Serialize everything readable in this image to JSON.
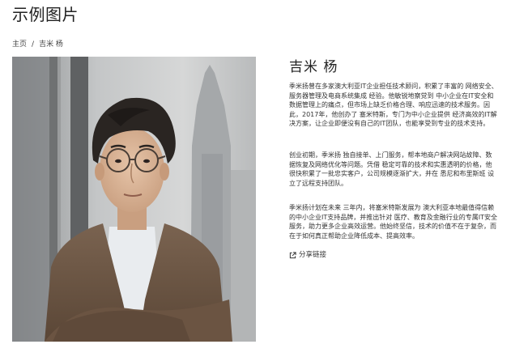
{
  "page": {
    "title": "示例图片"
  },
  "breadcrumb": {
    "home": "主页",
    "separator": "/",
    "current": "吉米 杨"
  },
  "profile": {
    "name": "吉米 杨",
    "photo_alt": "吉米 杨",
    "bio": [
      "季米扬曾在多家澳大利亚IT企业担任技术顾问，积累了丰富的 网络安全、服务器管理及电商系统集成 经验。他敏锐地察觉到 中小企业在IT安全和数据管理上的痛点，但市场上缺乏价格合理、响应迅速的技术服务。因此，2017年，他创办了 塞米特斯，专门为中小企业提供 经济高效的IT解决方案，让企业即便没有自己的IT团队，也能享受到专业的技术支持。",
      "创业初期，季米扬 独自接单、上门服务，帮本地商户解决网站故障、数据恢复及网络优化等问题。凭借 稳定可靠的技术和实惠透明的价格，他很快积累了一批忠实客户，公司规模逐渐扩大，并在 悉尼和布里斯班 设立了远程支持团队。",
      "季米扬计划在未来 三年内，将塞米特斯发展为 澳大利亚本地最值得信赖的中小企业IT支持品牌，并推出针对 医疗、教育及金融行业的专属IT安全服务，助力更多企业高效运营。他始终坚信，技术的价值不在于复杂，而在于如何真正帮助企业降低成本、提高效率。"
    ],
    "share_label": "分享链接"
  },
  "icons": {
    "share": "share-icon"
  },
  "colors": {
    "text": "#333333",
    "title": "#222222",
    "background": "#ffffff"
  }
}
